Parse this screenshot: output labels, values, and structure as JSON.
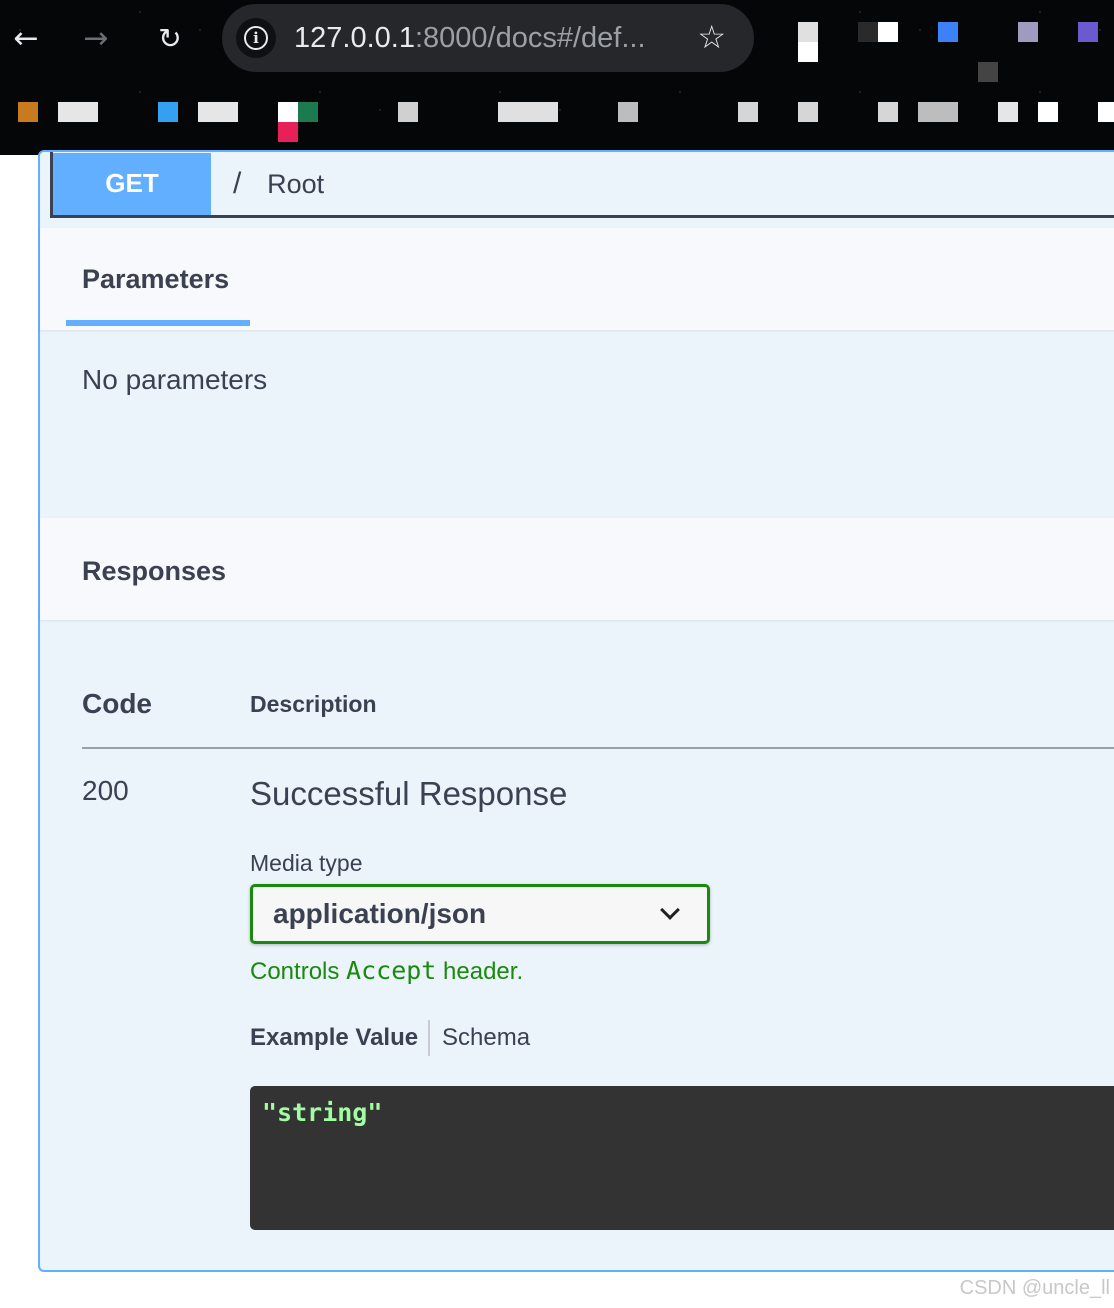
{
  "browser": {
    "url_host": "127.0.0.1",
    "url_rest": ":8000/docs#/def...",
    "accent": "#25272b"
  },
  "operation": {
    "method": "GET",
    "path": "/",
    "summary": "Root",
    "method_color": "#61affe"
  },
  "parameters": {
    "tab_label": "Parameters",
    "empty_text": "No parameters"
  },
  "responses": {
    "title": "Responses",
    "col_code": "Code",
    "col_description": "Description",
    "rows": [
      {
        "code": "200",
        "description": "Successful Response",
        "media_type_label": "Media type",
        "media_type_value": "application/json",
        "controls_prefix": "Controls",
        "controls_code": "Accept",
        "controls_suffix": "header.",
        "example_tab": "Example Value",
        "schema_tab": "Schema",
        "example_value": "\"string\""
      }
    ]
  },
  "watermark": "CSDN @uncle_ll"
}
